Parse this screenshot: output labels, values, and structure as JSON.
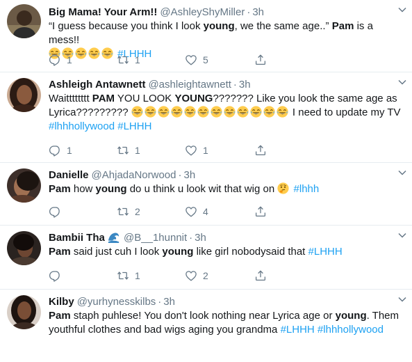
{
  "tweets": [
    {
      "name": "Big Mama! Your Arm!!",
      "handle": "@AshleyShyMiller",
      "dot": "·",
      "time": "3h",
      "text": {
        "p1": "“I guess because you think I look ",
        "b1": "young",
        "p2": ", we the same age..” ",
        "b2": "Pam",
        "p3": " is a mess!!",
        "emoji_count": "5",
        "tag1": "#LHHH"
      },
      "stats": {
        "reply": "1",
        "retweet": "1",
        "like": "5"
      }
    },
    {
      "name": "Ashleigh Antawnett",
      "handle": "@ashleightawnett",
      "dot": "·",
      "time": "3h",
      "text": {
        "p1": "Waitttttttt ",
        "b1": "PAM",
        "p2": " YOU LOOK ",
        "b2": "YOUNG",
        "p3": "??????? Like you look the same age as Lyrica?????????",
        "p4": " I need to update my TV ",
        "tag1": "#lhhhollywood",
        "tag2": "#LHHH"
      },
      "stats": {
        "reply": "1",
        "retweet": "1",
        "like": "1"
      }
    },
    {
      "name": "Danielle",
      "handle": "@AhjadaNorwood",
      "dot": "·",
      "time": "3h",
      "text": {
        "b1": "Pam",
        "p1": " how ",
        "b2": "young",
        "p2": " do u think u look wit that wig on ",
        "tag1": "#lhhh"
      },
      "stats": {
        "reply": "",
        "retweet": "2",
        "like": "4"
      }
    },
    {
      "name": "Bambii Tha",
      "handle": "@B__1hunnit",
      "dot": "·",
      "time": "3h",
      "text": {
        "b1": "Pam",
        "p1": " said just cuh I look ",
        "b2": "young",
        "p2": " like girl nobodysaid that ",
        "tag1": "#LHHH"
      },
      "stats": {
        "reply": "",
        "retweet": "1",
        "like": "2"
      }
    },
    {
      "name": "Kilby",
      "handle": "@yurhynesskilbs",
      "dot": "·",
      "time": "3h",
      "text": {
        "b1": "Pam",
        "p1": " staph puhlese! You don't look nothing near Lyrica age or ",
        "b2": "young",
        "p2": ". Them youthful clothes and bad wigs aging you grandma ",
        "tag1": "#LHHH",
        "tag2": "#lhhhollywood"
      },
      "stats": {
        "reply": "",
        "retweet": "",
        "like": ""
      }
    }
  ],
  "colors": {
    "accent": "#1da1f2",
    "muted": "#657786",
    "text": "#14171a",
    "divider": "#e6ecf0"
  },
  "icons": [
    "reply-icon",
    "retweet-icon",
    "like-icon",
    "share-icon",
    "chevron-down-icon",
    "wave-emoji-icon",
    "laughing-emoji-icon",
    "thinking-emoji-icon"
  ]
}
